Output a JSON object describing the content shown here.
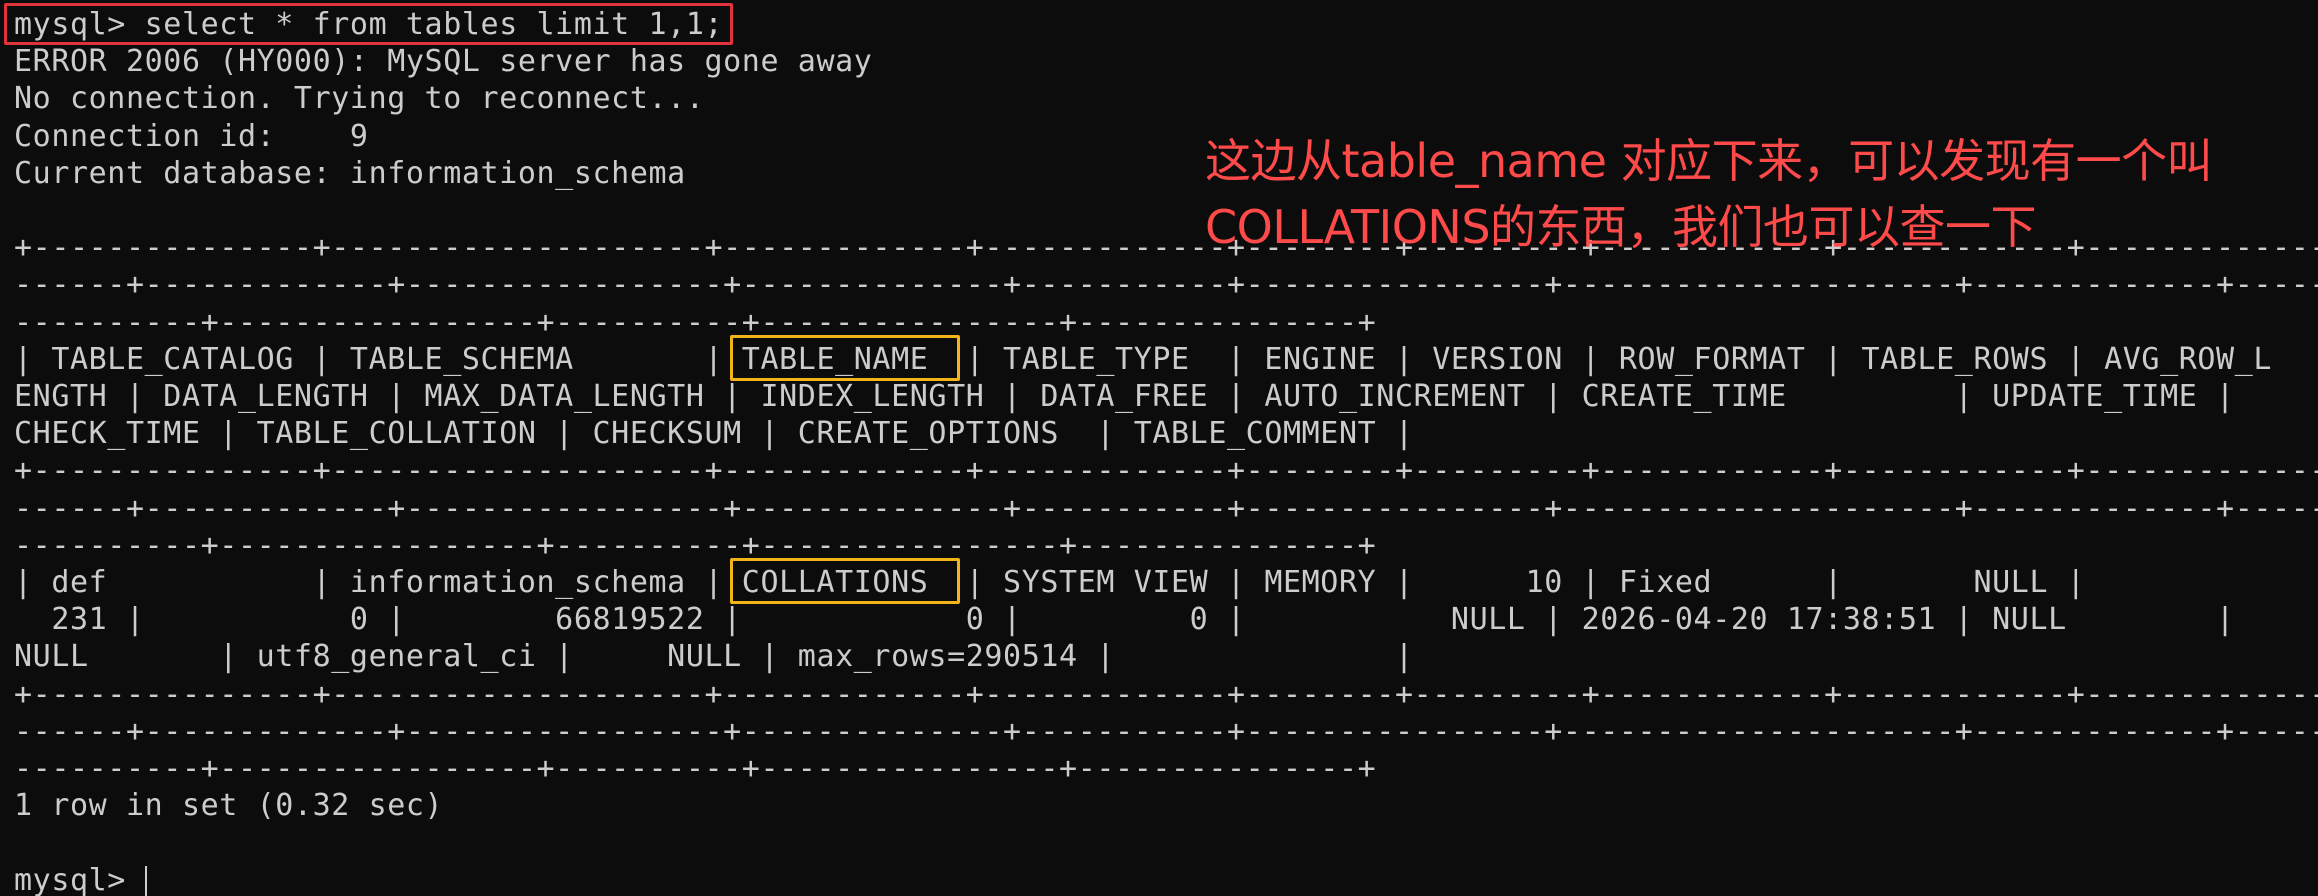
{
  "terminal": {
    "lines": [
      "mysql> select * from tables limit 1,1;",
      "ERROR 2006 (HY000): MySQL server has gone away",
      "No connection. Trying to reconnect...",
      "Connection id:    9",
      "Current database: information_schema",
      "",
      "+---------------+--------------------+-------------+-------------+--------+---------+------------+------------+---------------+",
      "------+-------------+-----------------+--------------+-----------+----------------+---------------------+-------------+-----------",
      "----------+-----------------+----------+----------------+---------------+",
      "| TABLE_CATALOG | TABLE_SCHEMA       | TABLE_NAME  | TABLE_TYPE  | ENGINE | VERSION | ROW_FORMAT | TABLE_ROWS | AVG_ROW_L",
      "ENGTH | DATA_LENGTH | MAX_DATA_LENGTH | INDEX_LENGTH | DATA_FREE | AUTO_INCREMENT | CREATE_TIME         | UPDATE_TIME |",
      "CHECK_TIME | TABLE_COLLATION | CHECKSUM | CREATE_OPTIONS  | TABLE_COMMENT |",
      "+---------------+--------------------+-------------+-------------+--------+---------+------------+------------+---------------+",
      "------+-------------+-----------------+--------------+-----------+----------------+---------------------+-------------+-----------",
      "----------+-----------------+----------+----------------+---------------+",
      "| def           | information_schema | COLLATIONS  | SYSTEM VIEW | MEMORY |      10 | Fixed      |       NULL |",
      "  231 |           0 |        66819522 |            0 |         0 |           NULL | 2026-04-20 17:38:51 | NULL        |",
      "NULL       | utf8_general_ci |     NULL | max_rows=290514 |               |",
      "+---------------+--------------------+-------------+-------------+--------+---------+------------+------------+---------------+",
      "------+-------------+-----------------+--------------+-----------+----------------+---------------------+-------------+-----------",
      "----------+-----------------+----------+----------------+---------------+",
      "1 row in set (0.32 sec)",
      "",
      "mysql> "
    ]
  },
  "annotation": {
    "line1": "这边从table_name 对应下来，可以发现有一个叫",
    "line2": "COLLATIONS的东西，我们也可以查一下"
  },
  "colors": {
    "background": "#0c0c0c",
    "text": "#cccccc",
    "note": "#ff4a4a",
    "highlight_red": "#e0323a",
    "highlight_yellow": "#f2b416"
  }
}
